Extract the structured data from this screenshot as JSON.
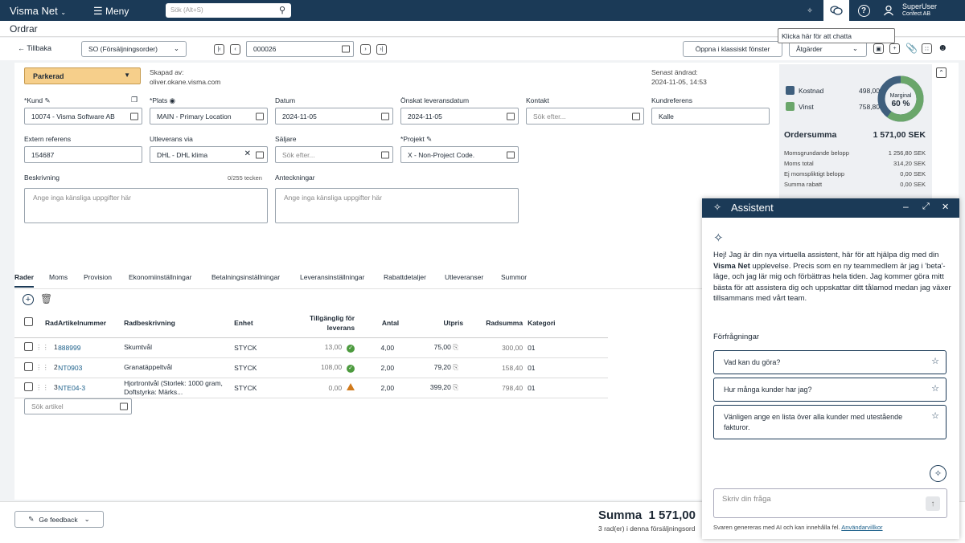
{
  "topbar": {
    "brand": "Visma Net",
    "menu": "Meny",
    "search_placeholder": "Sök (Alt+S)",
    "user_name": "SuperUser",
    "company": "Confect AB",
    "icons": [
      "sparkle-icon",
      "chat-icon",
      "help-icon",
      "user-icon"
    ]
  },
  "page_title": "Ordrar",
  "toolbar": {
    "back": "Tillbaka",
    "order_type": "SO (Försäljningsorder)",
    "order_number": "000026",
    "classic": "Öppna i klassiskt fönster",
    "actions": "Åtgärder"
  },
  "tooltip": "Klicka här för att chatta",
  "header": {
    "status": "Parkerad",
    "created_label": "Skapad av:",
    "created_by": "oliver.okane.visma.com",
    "modified_label": "Senast ändrad:",
    "modified_at": "2024-11-05, 14:53"
  },
  "fields": {
    "kund_label": "Kund",
    "kund": "10074 - Visma Software AB",
    "plats_label": "Plats",
    "plats": "MAIN - Primary Location",
    "datum_label": "Datum",
    "datum": "2024-11-05",
    "leveransdatum_label": "Önskat leveransdatum",
    "leveransdatum": "2024-11-05",
    "kontakt_label": "Kontakt",
    "kontakt_ph": "Sök efter...",
    "kundref_label": "Kundreferens",
    "kundref": "Kalle",
    "extref_label": "Extern referens",
    "extref": "154687",
    "utleverans_label": "Utleverans via",
    "utleverans": "DHL - DHL klima",
    "saljare_label": "Säljare",
    "saljare_ph": "Sök efter...",
    "projekt_label": "Projekt",
    "projekt": "X - Non-Project Code.",
    "beskrivning_label": "Beskrivning",
    "beskrivning_count": "0/255 tecken",
    "beskrivning_ph": "Ange inga känsliga uppgifter här",
    "anteckningar_label": "Anteckningar",
    "anteckningar_ph": "Ange inga känsliga uppgifter här"
  },
  "summary": {
    "kostnad_label": "Kostnad",
    "kostnad": "498,00",
    "vinst_label": "Vinst",
    "vinst": "758,80",
    "marginal_label": "Marginal",
    "marginal": "60 %",
    "marginal_fraction": 0.6,
    "ordersumma_label": "Ordersumma",
    "ordersumma": "1 571,00 SEK",
    "rows": [
      {
        "label": "Momsgrundande belopp",
        "value": "1 256,80 SEK"
      },
      {
        "label": "Moms total",
        "value": "314,20 SEK"
      },
      {
        "label": "Ej momspliktigt belopp",
        "value": "0,00 SEK"
      },
      {
        "label": "Summa rabatt",
        "value": "0,00 SEK"
      }
    ],
    "colors": {
      "kostnad": "#3f5f7d",
      "vinst": "#6aa66a"
    }
  },
  "tabs": [
    "Rader",
    "Moms",
    "Provision",
    "Ekonomiinställningar",
    "Betalningsinställningar",
    "Leveransinställningar",
    "Rabattdetaljer",
    "Utleveranser",
    "Summor"
  ],
  "grid": {
    "headers": {
      "rad": "Rad",
      "artikel": "Artikelnummer",
      "besk": "Radbeskrivning",
      "enhet": "Enhet",
      "tillg1": "Tillgänglig för",
      "tillg2": "leverans",
      "antal": "Antal",
      "utpris": "Utpris",
      "radsumma": "Radsumma",
      "kategori": "Kategori"
    },
    "rows": [
      {
        "rad": "1",
        "artikel": "888999",
        "besk": "Skumtvål",
        "enhet": "STYCK",
        "tillg": "13,00",
        "status": "ok",
        "antal": "4,00",
        "utpris": "75,00",
        "radsumma": "300,00",
        "kategori": "01"
      },
      {
        "rad": "2",
        "artikel": "NT0903",
        "besk": "Granatäppeltvål",
        "enhet": "STYCK",
        "tillg": "108,00",
        "status": "ok",
        "antal": "2,00",
        "utpris": "79,20",
        "radsumma": "158,40",
        "kategori": "01"
      },
      {
        "rad": "3",
        "artikel": "NTE04-3",
        "besk": "Hjortrontvål (Storlek: 1000 gram, Doftstyrka: Märks...",
        "enhet": "STYCK",
        "tillg": "0,00",
        "status": "warn",
        "antal": "2,00",
        "utpris": "399,20",
        "radsumma": "798,40",
        "kategori": "01"
      }
    ],
    "search_placeholder": "Sök artikel"
  },
  "footer": {
    "feedback": "Ge feedback",
    "summa_label": "Summa",
    "summa": "1 571,00",
    "rows_text": "3 rad(er) i denna försäljningsord"
  },
  "assistant": {
    "title": "Assistent",
    "intro_pre": "Hej! Jag är din nya virtuella assistent, här för att hjälpa dig med din ",
    "intro_brand": "Visma Net",
    "intro_post": " upplevelse. Precis som en ny teammedlem är jag i 'beta'-läge, och jag lär mig och förbättras hela tiden. Jag kommer göra mitt bästa för att assistera dig och uppskattar ditt tålamod medan jag växer tillsammans med vårt team.",
    "queries_label": "Förfrågningar",
    "queries": [
      "Vad kan du göra?",
      "Hur många kunder har jag?",
      "Vänligen ange en lista över alla kunder med utestående fakturor."
    ],
    "input_placeholder": "Skriv din fråga",
    "disclaimer": "Svaren genereras med AI och kan innehålla fel.",
    "terms": "Användarvillkor"
  }
}
